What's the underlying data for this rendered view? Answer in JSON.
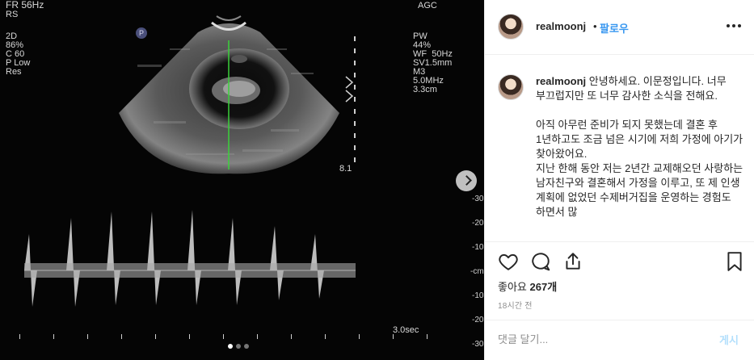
{
  "media": {
    "top_left": "FR 56Hz",
    "sub_left": "RS",
    "left_params": "2D\n86%\nC 60\nP Low\nRes",
    "top_right": "AGC",
    "right_params": "PW\n44%\nWF  50Hz\nSV1.5mm\nM3\n5.0MHz\n3.3cm",
    "probe_marker": "P",
    "depth_label": "8.1",
    "time_label": "3.0sec",
    "scale_labels": [
      "-30",
      "-20",
      "-10",
      "-cm",
      "-10",
      "-20",
      "-30"
    ],
    "carousel_dots": 3,
    "active_dot": 0
  },
  "header": {
    "username": "realmoonj",
    "separator": "•",
    "follow_label": "팔로우"
  },
  "caption": {
    "username": "realmoonj",
    "text": " 안녕하세요. 이문정입니다. 너무 부끄럽지만 또 너무 감사한 소식을 전해요.\n\n아직 아무런 준비가 되지 못했는데 결혼 후 1년하고도 조금 넘은 시기에 저희 가정에 아기가 찾아왔어요.\n지난 한해 동안 저는 2년간 교제해오던 사랑하는 남자친구와 결혼해서 가정을 이루고, 또 제 인생 계획에 없었던 수제버거집을 운영하는 경험도 하면서 많"
  },
  "engagement": {
    "likes_label": "좋아요",
    "likes_count": "267개",
    "time_ago": "18시간 전"
  },
  "comment": {
    "placeholder": "댓글 달기...",
    "post_label": "게시"
  },
  "colors": {
    "accent": "#3897f0",
    "post_disabled": "#b2dffc",
    "text": "#262626",
    "muted": "#8e8e8e"
  }
}
